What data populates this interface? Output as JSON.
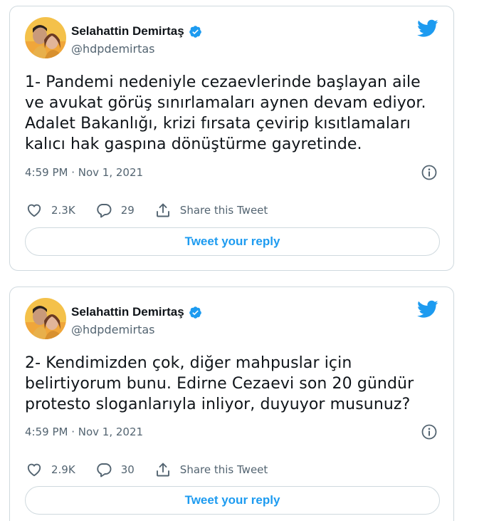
{
  "colors": {
    "accent": "#1d9bf0",
    "text": "#0f1419",
    "muted": "#536471",
    "border": "#cfd9de"
  },
  "tweets": [
    {
      "author_name": "Selahattin Demirtaş",
      "handle": "@hdpdemirtas",
      "verified": true,
      "text": "1- Pandemi nedeniyle cezaevlerinde başlayan aile ve avukat görüş sınırlamaları aynen devam ediyor. Adalet Bakanlığı, krizi fırsata çevirip kısıtlamaları kalıcı hak gaspına dönüştürme gayretinde.",
      "timestamp": "4:59 PM · Nov 1, 2021",
      "likes": "2.3K",
      "replies": "29",
      "share_label": "Share this Tweet",
      "reply_button_label": "Tweet your reply",
      "icons": [
        "twitter-bird-icon",
        "verified-badge-icon",
        "info-icon",
        "heart-icon",
        "reply-bubble-icon",
        "share-icon"
      ]
    },
    {
      "author_name": "Selahattin Demirtaş",
      "handle": "@hdpdemirtas",
      "verified": true,
      "text": "2- Kendimizden çok, diğer mahpuslar için belirtiyorum bunu. Edirne Cezaevi son 20 gündür protesto sloganlarıyla inliyor, duyuyor musunuz?",
      "timestamp": "4:59 PM · Nov 1, 2021",
      "likes": "2.9K",
      "replies": "30",
      "share_label": "Share this Tweet",
      "reply_button_label": "Tweet your reply",
      "icons": [
        "twitter-bird-icon",
        "verified-badge-icon",
        "info-icon",
        "heart-icon",
        "reply-bubble-icon",
        "share-icon"
      ]
    }
  ]
}
